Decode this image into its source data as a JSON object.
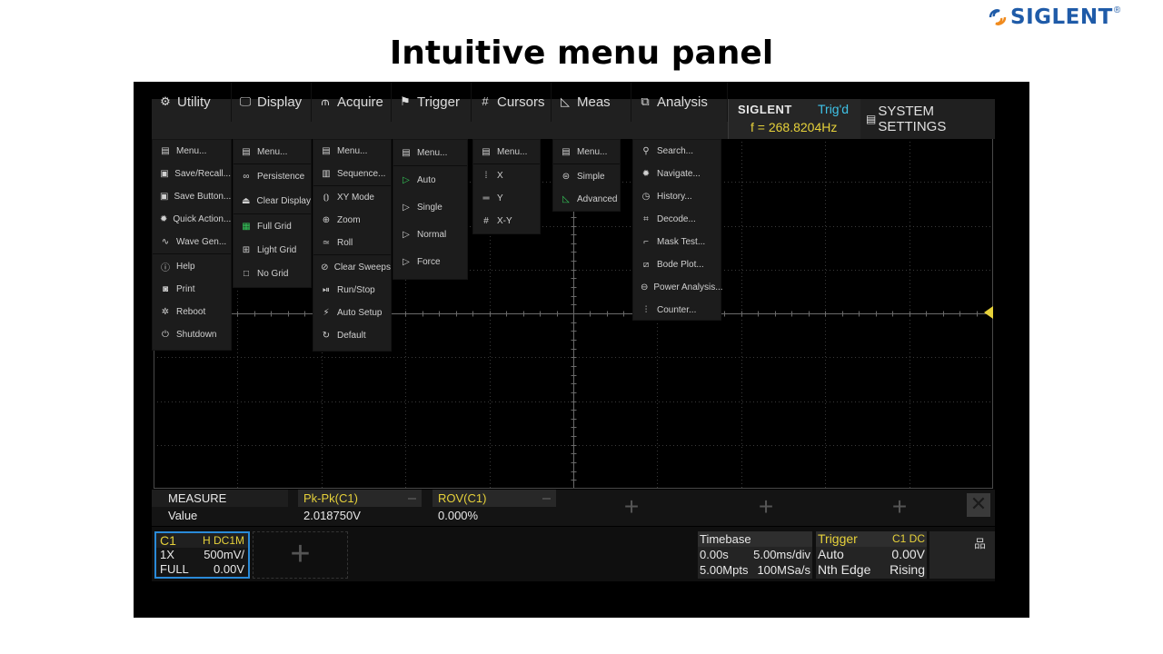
{
  "brand": {
    "logo_text": "SIGLENT",
    "registered": "®"
  },
  "slide_title": "Intuitive menu panel",
  "menubar": {
    "tabs": [
      {
        "label": "Utility",
        "icon": "gear-icon"
      },
      {
        "label": "Display",
        "icon": "monitor-icon"
      },
      {
        "label": "Acquire",
        "icon": "acquire-icon"
      },
      {
        "label": "Trigger",
        "icon": "flag-icon"
      },
      {
        "label": "Cursors",
        "icon": "cursor-grid-icon"
      },
      {
        "label": "Meas",
        "icon": "ruler-icon"
      },
      {
        "label": "Analysis",
        "icon": "analysis-icon"
      }
    ],
    "status": {
      "brand": "SIGLENT",
      "trig_state": "Trig'd",
      "frequency": "f = 268.8204Hz"
    },
    "system_settings": "SYSTEM SETTINGS"
  },
  "menus": {
    "utility": [
      "Menu...",
      "Save/Recall...",
      "Save Button...",
      "Quick Action...",
      "Wave Gen...",
      "Help",
      "Print",
      "Reboot",
      "Shutdown"
    ],
    "display": [
      "Menu...",
      "Persistence",
      "Clear Display",
      "Full Grid",
      "Light Grid",
      "No Grid"
    ],
    "acquire": [
      "Menu...",
      "Sequence...",
      "XY Mode",
      "Zoom",
      "Roll",
      "Clear Sweeps",
      "Run/Stop",
      "Auto Setup",
      "Default"
    ],
    "trigger": [
      "Menu...",
      "Auto",
      "Single",
      "Normal",
      "Force"
    ],
    "cursors": [
      "Menu...",
      "X",
      "Y",
      "X-Y"
    ],
    "meas": [
      "Menu...",
      "Simple",
      "Advanced"
    ],
    "analysis": [
      "Search...",
      "Navigate...",
      "History...",
      "Decode...",
      "Mask Test...",
      "Bode Plot...",
      "Power Analysis...",
      "Counter..."
    ]
  },
  "measure": {
    "label_head": "MEASURE",
    "label_value": "Value",
    "items": [
      {
        "name": "Pk-Pk(C1)",
        "value": "2.018750V"
      },
      {
        "name": "ROV(C1)",
        "value": "0.000%"
      }
    ],
    "add_symbol": "+",
    "close_symbol": "✕"
  },
  "channel1": {
    "name": "C1",
    "coupling": "H  DC1M",
    "probe": "1X",
    "scale": "500mV/",
    "bandwidth": "FULL",
    "offset": "0.00V"
  },
  "add_channel_symbol": "+",
  "timebase": {
    "title": "Timebase",
    "delay": "0.00s",
    "scale": "5.00ms/div",
    "memory": "5.00Mpts",
    "sample_rate": "100MSa/s"
  },
  "trigger_panel": {
    "title": "Trigger",
    "source": "C1 DC",
    "mode": "Auto",
    "level": "0.00V",
    "type": "Nth Edge",
    "slope": "Rising"
  },
  "colors": {
    "accent_yellow": "#e6d13a",
    "accent_cyan": "#3fc3e8",
    "channel_blue": "#2a8ad8",
    "green_icon": "#34c759",
    "brand_blue": "#1f5ba8"
  }
}
